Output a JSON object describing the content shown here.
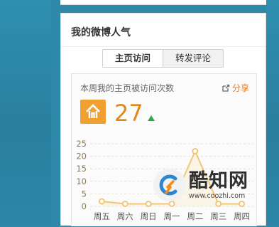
{
  "card": {
    "title": "我的微博人气",
    "tabs": [
      {
        "label": "主页访问",
        "active": true
      },
      {
        "label": "转发评论",
        "active": false
      }
    ]
  },
  "stats": {
    "label": "本周我的主页被访问次数",
    "share_label": "分享",
    "count": "27",
    "trend_icon": "up-arrow-icon",
    "home_icon": "home-icon"
  },
  "chart_data": {
    "type": "line",
    "categories": [
      "周五",
      "周六",
      "周日",
      "周一",
      "周二",
      "周三",
      "周四"
    ],
    "yticks": [
      "25",
      "20",
      "15",
      "10",
      "5",
      "0"
    ],
    "ylim": [
      0,
      25
    ],
    "series": [
      {
        "values": [
          2,
          1,
          1,
          1,
          22,
          1,
          1
        ],
        "color": "#f1c676"
      }
    ],
    "grid": true
  },
  "watermark": {
    "name": "酷知网",
    "url": "www.coozhi.com"
  },
  "colors": {
    "background": "#2e89a8",
    "accent": "#f0a030",
    "count": "#e08a1c",
    "up": "#2faa4a",
    "line": "#f1c676"
  }
}
